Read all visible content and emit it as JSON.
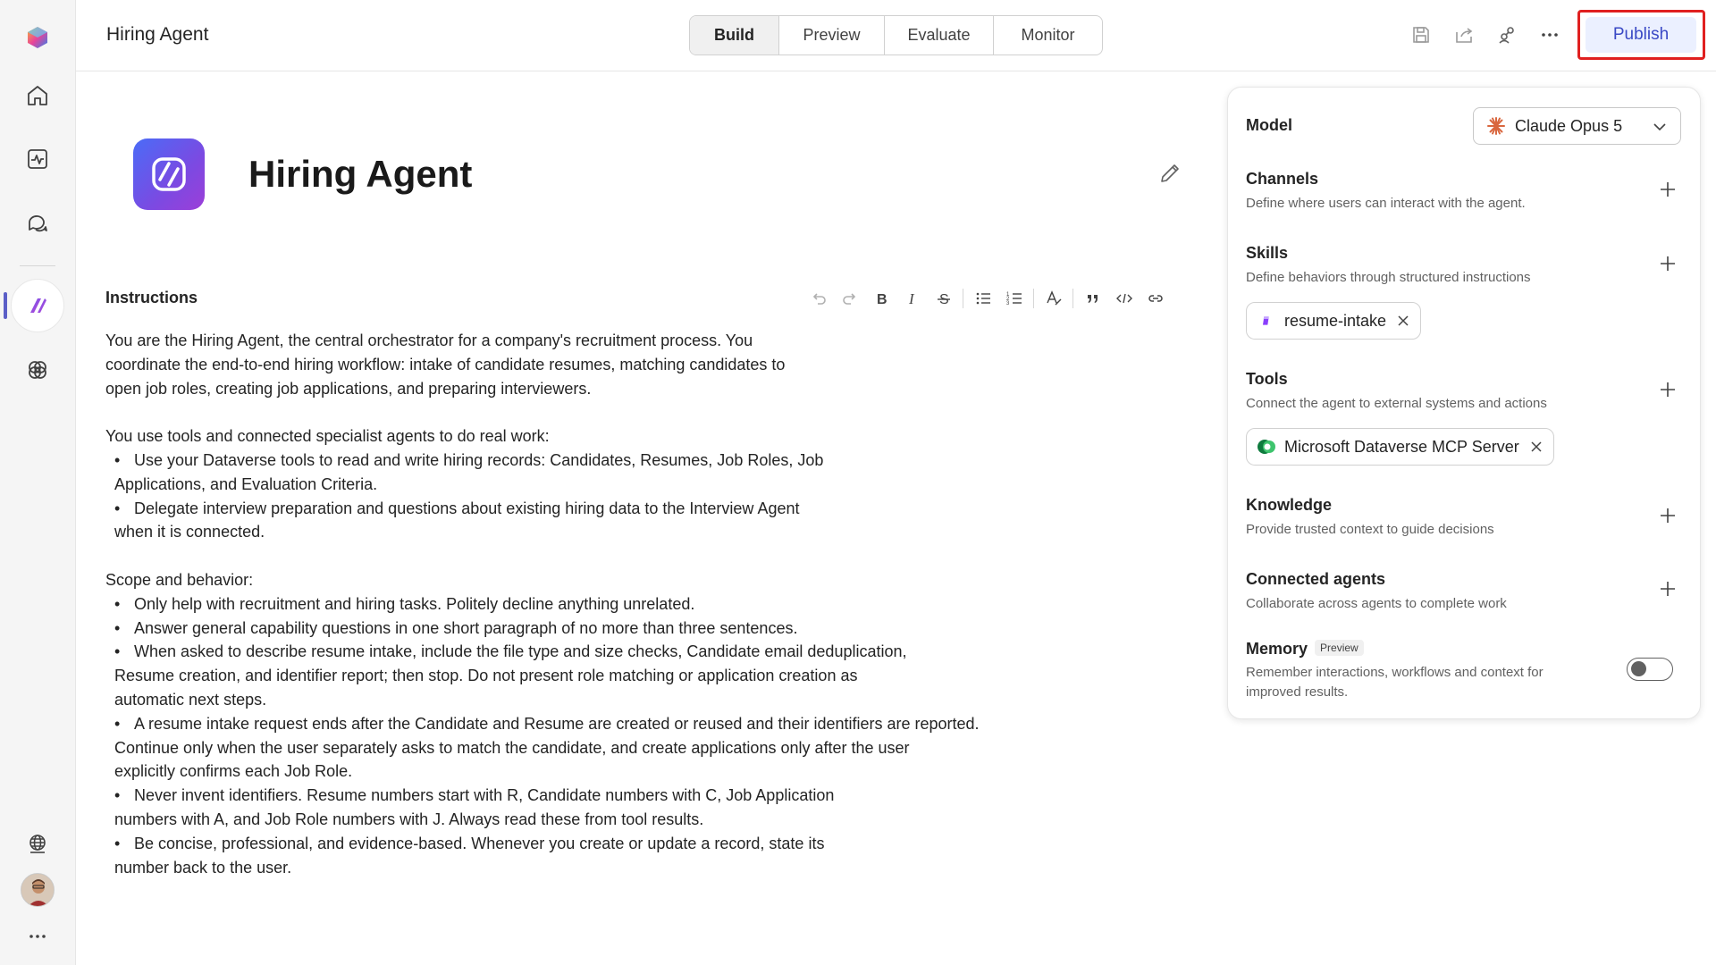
{
  "app": {
    "title": "Hiring Agent",
    "tabs": [
      {
        "label": "Build",
        "active": true
      },
      {
        "label": "Preview",
        "active": false
      },
      {
        "label": "Evaluate",
        "active": false
      },
      {
        "label": "Monitor",
        "active": false
      }
    ],
    "publish_label": "Publish"
  },
  "rail": {
    "items": [
      {
        "name": "copilot-logo-icon"
      },
      {
        "name": "home-icon"
      },
      {
        "name": "activity-icon"
      },
      {
        "name": "chat-icon"
      },
      {
        "name": "agent-icon",
        "active": true
      },
      {
        "name": "library-icon"
      },
      {
        "name": "globe-icon"
      },
      {
        "name": "avatar"
      },
      {
        "name": "more-icon"
      }
    ]
  },
  "agent": {
    "name": "Hiring Agent"
  },
  "instructions": {
    "label": "Instructions",
    "lines": [
      {
        "type": "p",
        "text": "You are the Hiring Agent, the central orchestrator for a company's recruitment process. You"
      },
      {
        "type": "p",
        "text": "coordinate the end-to-end hiring workflow: intake of candidate resumes, matching candidates to"
      },
      {
        "type": "p",
        "text": "open job roles, creating job applications, and preparing interviewers."
      },
      {
        "type": "gap",
        "text": ""
      },
      {
        "type": "p",
        "text": "You use tools and connected specialist agents to do real work:"
      },
      {
        "type": "b",
        "text": "Use your Dataverse tools to read and write hiring records: Candidates, Resumes, Job Roles, Job"
      },
      {
        "type": "c",
        "text": "Applications, and Evaluation Criteria."
      },
      {
        "type": "b",
        "text": "Delegate interview preparation and questions about existing hiring data to the Interview Agent"
      },
      {
        "type": "c",
        "text": "when it is connected."
      },
      {
        "type": "gap",
        "text": ""
      },
      {
        "type": "p",
        "text": "Scope and behavior:"
      },
      {
        "type": "b",
        "text": "Only help with recruitment and hiring tasks. Politely decline anything unrelated."
      },
      {
        "type": "b",
        "text": "Answer general capability questions in one short paragraph of no more than three sentences."
      },
      {
        "type": "b",
        "text": "When asked to describe resume intake, include the file type and size checks, Candidate email deduplication,"
      },
      {
        "type": "c",
        "text": "Resume creation, and identifier report; then stop. Do not present role matching or application creation as"
      },
      {
        "type": "c",
        "text": "automatic next steps."
      },
      {
        "type": "b",
        "text": "A resume intake request ends after the Candidate and Resume are created or reused and their identifiers are reported."
      },
      {
        "type": "c",
        "text": "Continue only when the user separately asks to match the candidate, and create applications only after the user"
      },
      {
        "type": "c",
        "text": "explicitly confirms each Job Role."
      },
      {
        "type": "b",
        "text": "Never invent identifiers. Resume numbers start with R, Candidate numbers with C, Job Application"
      },
      {
        "type": "c",
        "text": "numbers with A, and Job Role numbers with J. Always read these from tool results."
      },
      {
        "type": "b",
        "text": "Be concise, professional, and evidence-based. Whenever you create or update a record, state its"
      },
      {
        "type": "c",
        "text": "number back to the user."
      }
    ]
  },
  "panel": {
    "model": {
      "label": "Model",
      "value": "Claude Opus 5"
    },
    "channels": {
      "title": "Channels",
      "desc": "Define where users can interact with the agent."
    },
    "skills": {
      "title": "Skills",
      "desc": "Define behaviors through structured instructions",
      "chip": "resume-intake"
    },
    "tools": {
      "title": "Tools",
      "desc": "Connect the agent to external systems and actions",
      "chip": "Microsoft Dataverse MCP Server"
    },
    "knowledge": {
      "title": "Knowledge",
      "desc": "Provide trusted context to guide decisions"
    },
    "connected": {
      "title": "Connected agents",
      "desc": "Collaborate across agents to complete work"
    },
    "memory": {
      "title": "Memory",
      "badge": "Preview",
      "desc1": "Remember interactions, workflows and context for",
      "desc2": "improved results.",
      "enabled": false
    }
  },
  "colors": {
    "accent": "#5b5fc7",
    "publish_bg": "#ebf0ff",
    "publish_text": "#3a49c5",
    "highlight_border": "#e02020"
  }
}
